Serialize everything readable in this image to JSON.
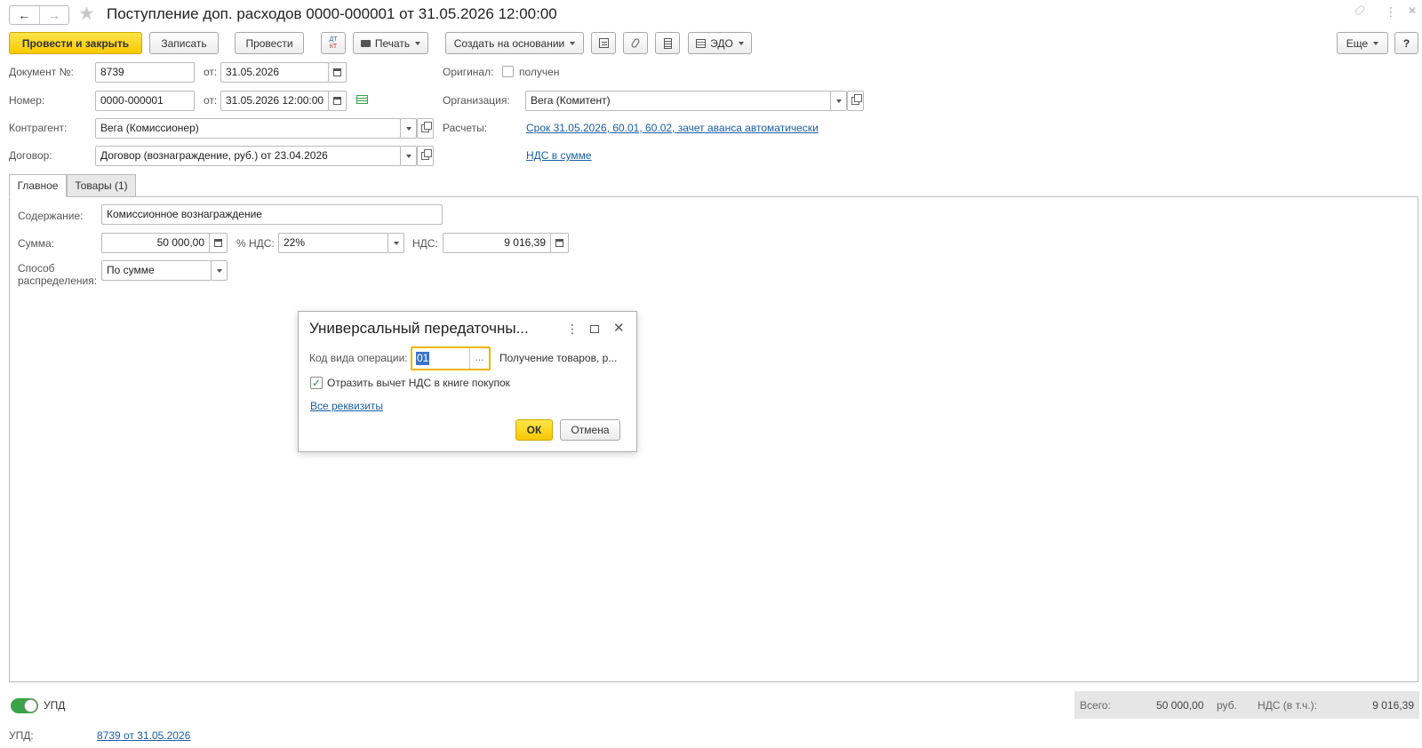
{
  "window": {
    "title": "Поступление доп. расходов 0000-000001 от 31.05.2026 12:00:00",
    "nav_back": "←",
    "nav_forward": "→",
    "star_icon": "☆"
  },
  "toolbar": {
    "post_close": "Провести и закрыть",
    "save": "Записать",
    "post": "Провести",
    "dt_kt_top": "ДТ",
    "dt_kt_bottom": "КТ",
    "print": "Печать",
    "create_based": "Создать на основании",
    "edo": "ЭДО",
    "more": "Еще",
    "help": "?"
  },
  "header": {
    "doc_no_label": "Документ №:",
    "doc_no": "8739",
    "from_label": "от:",
    "doc_date": "31.05.2026",
    "original_label": "Оригинал:",
    "original_received": "получен",
    "number_label": "Номер:",
    "number": "0000-000001",
    "number_date": "31.05.2026 12:00:00",
    "org_label": "Организация:",
    "org": "Вега (Комитент)",
    "counterparty_label": "Контрагент:",
    "counterparty": "Вега (Комиссионер)",
    "payments_label": "Расчеты:",
    "payments_link": "Срок 31.05.2026, 60.01, 60.02, зачет аванса автоматически",
    "contract_label": "Договор:",
    "contract": "Договор (вознаграждение, руб.) от 23.04.2026",
    "vat_link": "НДС в сумме"
  },
  "tabs": [
    {
      "label": "Главное",
      "active": true
    },
    {
      "label": "Товары (1)",
      "active": false
    }
  ],
  "main": {
    "content_label": "Содержание:",
    "content": "Комиссионное вознаграждение",
    "sum_label": "Сумма:",
    "sum": "50 000,00",
    "vat_rate_label": "% НДС:",
    "vat_rate": "22%",
    "vat_label": "НДС:",
    "vat": "9 016,39",
    "distribution_label_1": "Способ",
    "distribution_label_2": "распределения:",
    "distribution": "По сумме"
  },
  "dialog": {
    "title": "Универсальный передаточны...",
    "op_code_label": "Код вида операции:",
    "op_code": "01",
    "op_code_desc": "Получение товаров, р...",
    "vat_deduction_label": "Отразить вычет НДС в книге покупок",
    "vat_deduction_checked": true,
    "all_details": "Все реквизиты",
    "ok": "ОК",
    "cancel": "Отмена"
  },
  "footer": {
    "upd_toggle_label": "УПД",
    "upd_label": "УПД:",
    "upd_link": "8739 от 31.05.2026",
    "total_label": "Всего:",
    "total": "50 000,00",
    "currency": "руб.",
    "vat_incl_label": "НДС (в т.ч.):",
    "vat_incl": "9 016,39"
  },
  "colors": {
    "primary_button": "#f6c800",
    "link": "#1b5fa7",
    "toggle_on": "#3aa347",
    "focus": "#f0b400"
  }
}
